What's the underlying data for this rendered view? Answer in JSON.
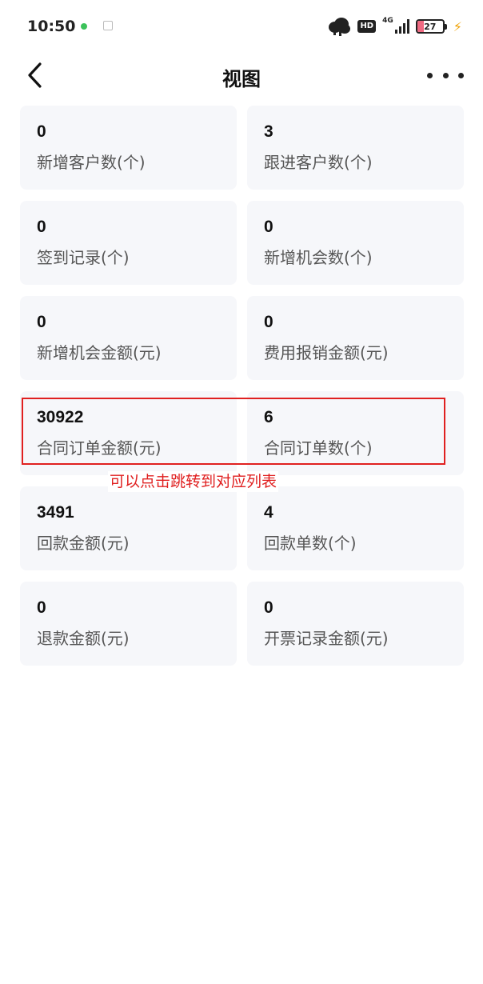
{
  "status_bar": {
    "time": "10:50",
    "network": "4G",
    "hd": "HD",
    "battery": "27",
    "battery_level": 0.27,
    "dot_color": "#3cc25a"
  },
  "header": {
    "title": "视图"
  },
  "cards": [
    {
      "value": "0",
      "label": "新增客户数(个)"
    },
    {
      "value": "3",
      "label": "跟进客户数(个)"
    },
    {
      "value": "0",
      "label": "签到记录(个)"
    },
    {
      "value": "0",
      "label": "新增机会数(个)"
    },
    {
      "value": "0",
      "label": "新增机会金额(元)"
    },
    {
      "value": "0",
      "label": "费用报销金额(元)"
    },
    {
      "value": "30922",
      "label": "合同订单金额(元)"
    },
    {
      "value": "6",
      "label": "合同订单数(个)"
    },
    {
      "value": "3491",
      "label": "回款金额(元)"
    },
    {
      "value": "4",
      "label": "回款单数(个)"
    },
    {
      "value": "0",
      "label": "退款金额(元)"
    },
    {
      "value": "0",
      "label": "开票记录金额(元)"
    }
  ],
  "annotation": {
    "text": "可以点击跳转到对应列表",
    "color": "#e02020"
  },
  "colors": {
    "card_bg": "#f6f7fa",
    "label": "#555555",
    "value": "#111111"
  }
}
